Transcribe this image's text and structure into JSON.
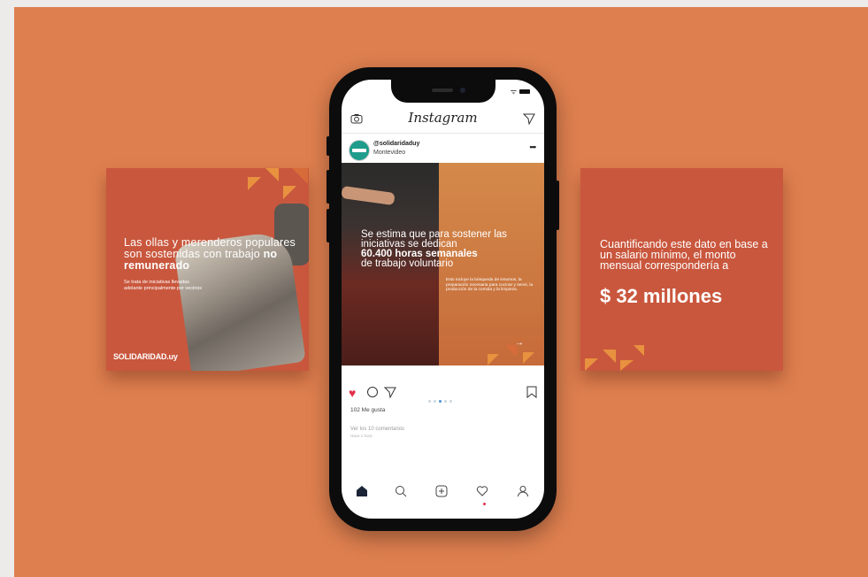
{
  "left_card": {
    "headline_part1": "Las ollas y merenderos populares son sostenidas con trabajo ",
    "headline_bold": "no remunerado",
    "small_text": "Se trata de iniciativas llevadas adelante principalmente por vecinos",
    "brand": "SOLIDARIDAD.uy"
  },
  "right_card": {
    "headline": "Cuantificando este dato en base a un salario mínimo, el monto mensual correspondería a",
    "big_value": "$ 32 millones"
  },
  "instagram": {
    "logo": "Instagram",
    "username": "@solidaridaduy",
    "location": "Montevideo",
    "more": "•••",
    "post": {
      "headline_line1": "Se estima que para sostener las iniciativas se dedican",
      "headline_bold": "60.400 horas semanales",
      "headline_line3": "de trabajo voluntario",
      "small_text": "Esto incluye la búsqueda de insumos, la preparación necesaria para cocinar y servir, la producción de la comida y la limpieza.",
      "arrow": "→"
    },
    "likes": "102 Me gusta",
    "comments_link": "Ver los 10 comentarios",
    "time_ago": "Hace 1 hora",
    "carousel": {
      "count": 5,
      "active": 2
    }
  },
  "colors": {
    "background": "#de7f4f",
    "card": "#c9573d",
    "accent_orange": "#e8913f",
    "like_red": "#e2314b",
    "dot_active": "#4b90d9"
  },
  "icons": [
    "camera-icon",
    "send-icon",
    "heart-icon",
    "comment-icon",
    "share-icon",
    "bookmark-icon",
    "home-icon",
    "search-icon",
    "add-icon",
    "activity-icon",
    "profile-icon"
  ]
}
